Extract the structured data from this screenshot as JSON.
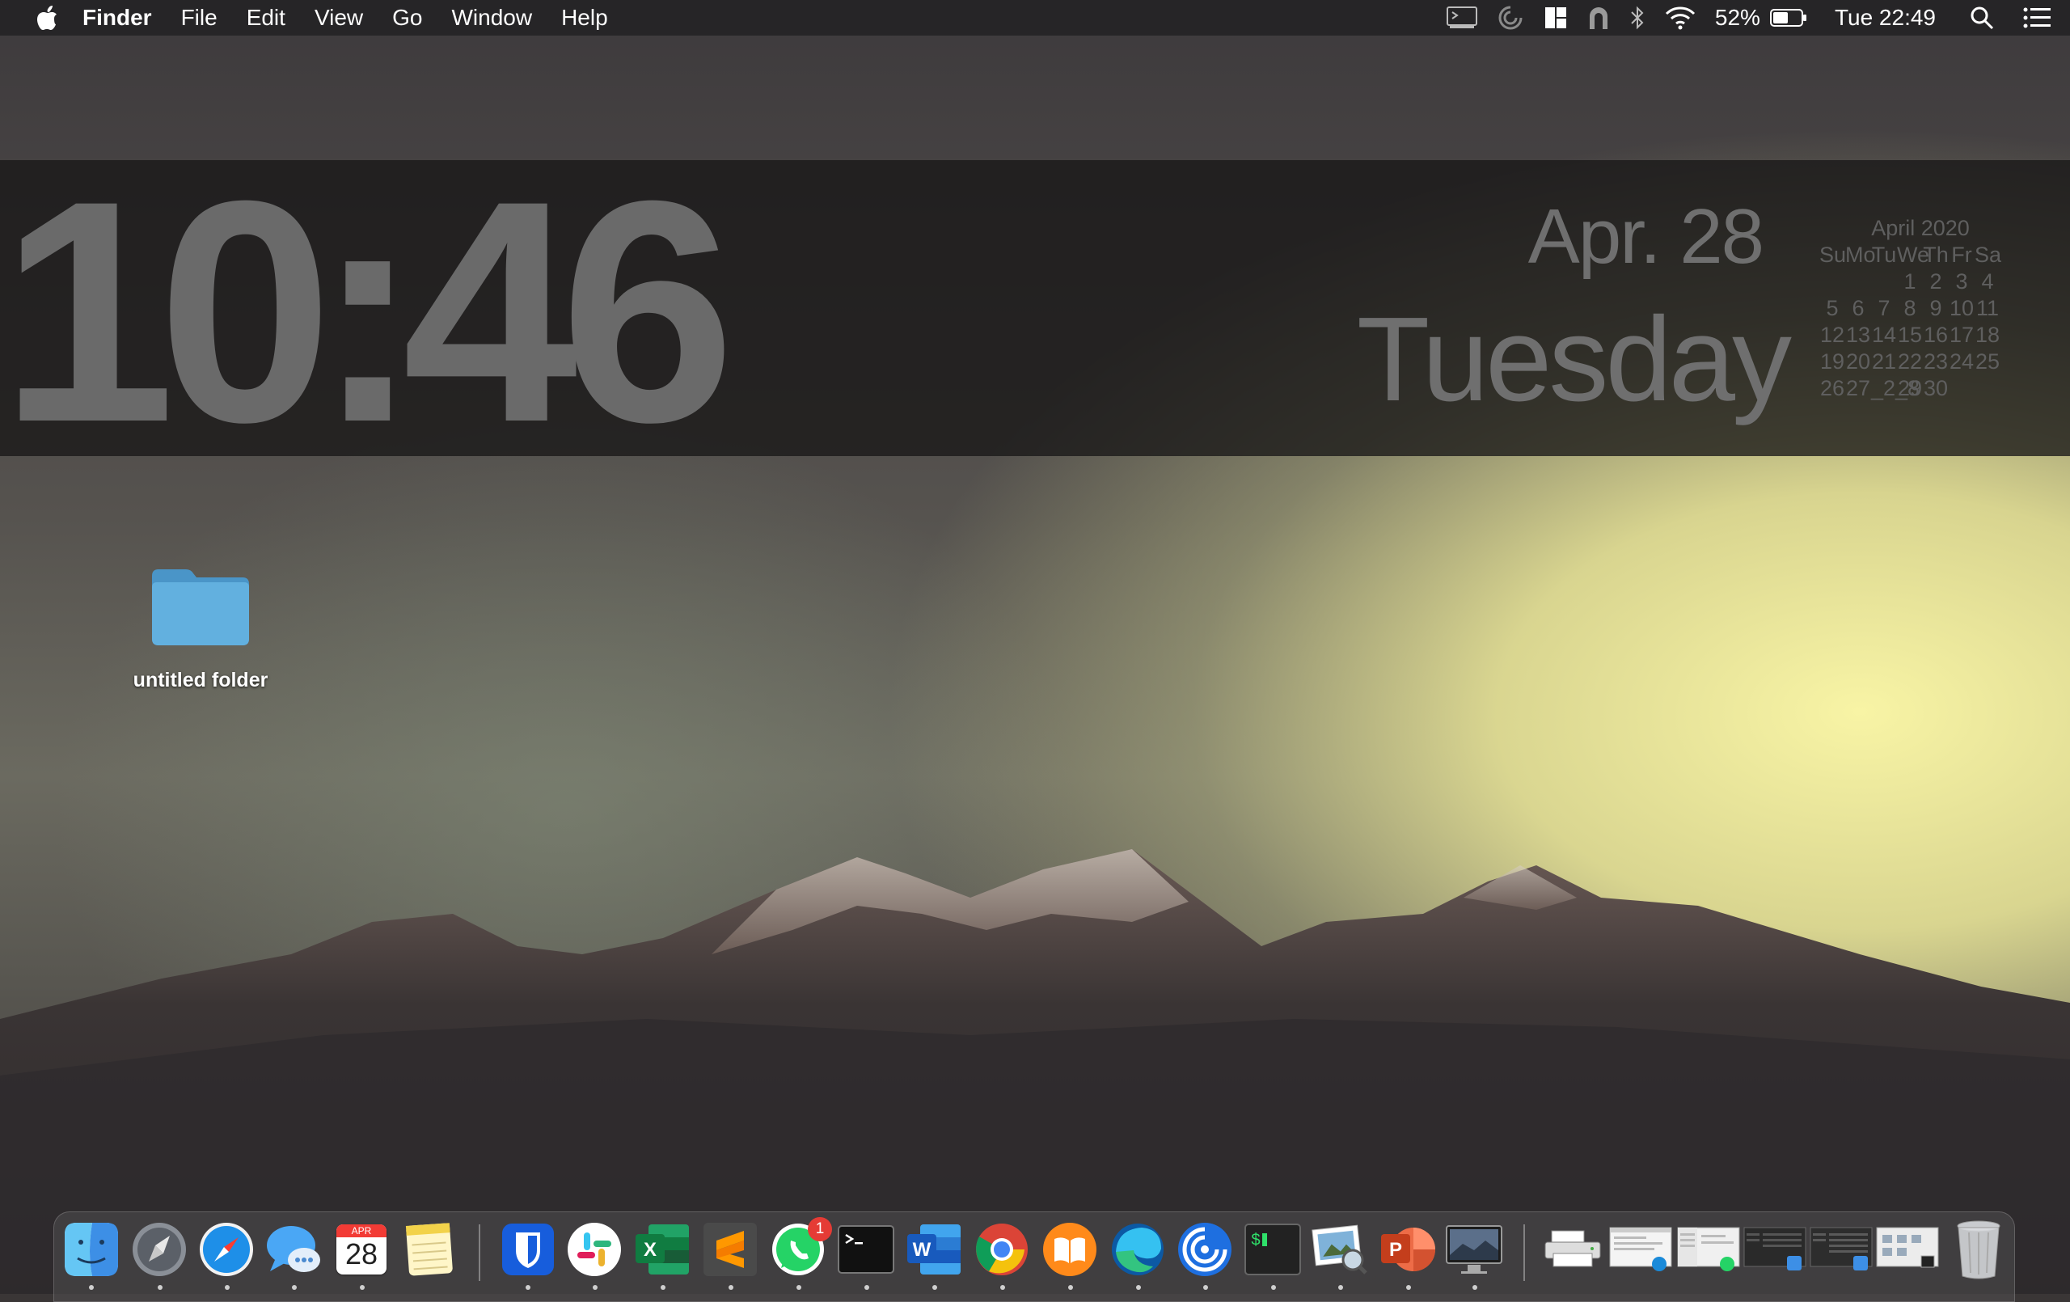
{
  "menubar": {
    "app_name": "Finder",
    "items": [
      "File",
      "Edit",
      "View",
      "Go",
      "Window",
      "Help"
    ],
    "battery_percent": "52%",
    "clock": "Tue 22:49"
  },
  "clock_widget": {
    "time": "10:46",
    "date": "Apr. 28",
    "weekday": "Tuesday",
    "calendar": {
      "title": "April 2020",
      "weekday_headers": [
        "Su",
        "Mo",
        "Tu",
        "We",
        "Th",
        "Fr",
        "Sa"
      ],
      "weeks": [
        [
          "",
          "",
          "",
          "1",
          "2",
          "3",
          "4"
        ],
        [
          "5",
          "6",
          "7",
          "8",
          "9",
          "10",
          "11"
        ],
        [
          "12",
          "13",
          "14",
          "15",
          "16",
          "17",
          "18"
        ],
        [
          "19",
          "20",
          "21",
          "22",
          "23",
          "24",
          "25"
        ],
        [
          "26",
          "27",
          "_2_8",
          "29",
          "30",
          "",
          ""
        ]
      ]
    }
  },
  "desktop": {
    "items": [
      {
        "label": "untitled folder",
        "icon": "folder-icon"
      }
    ]
  },
  "dock": {
    "calendar_month": "APR",
    "calendar_day": "28",
    "whatsapp_badge": "1",
    "apps": [
      "finder",
      "launchpad",
      "safari",
      "messages",
      "calendar",
      "notes",
      "bitwarden",
      "slack",
      "excel",
      "sublime-text",
      "whatsapp",
      "terminal",
      "word",
      "chrome",
      "books",
      "edge",
      "sync",
      "iterm",
      "preview",
      "powerpoint",
      "screenshot",
      "printer",
      "window-edge",
      "window-whatsapp",
      "window-finder-1",
      "window-finder-2",
      "window-system",
      "trash"
    ]
  },
  "colors": {
    "menubar_bg": "#262527",
    "clock_text": "#6a6a6a",
    "folder_blue": "#5aa7d8",
    "badge_red": "#e53b35"
  }
}
